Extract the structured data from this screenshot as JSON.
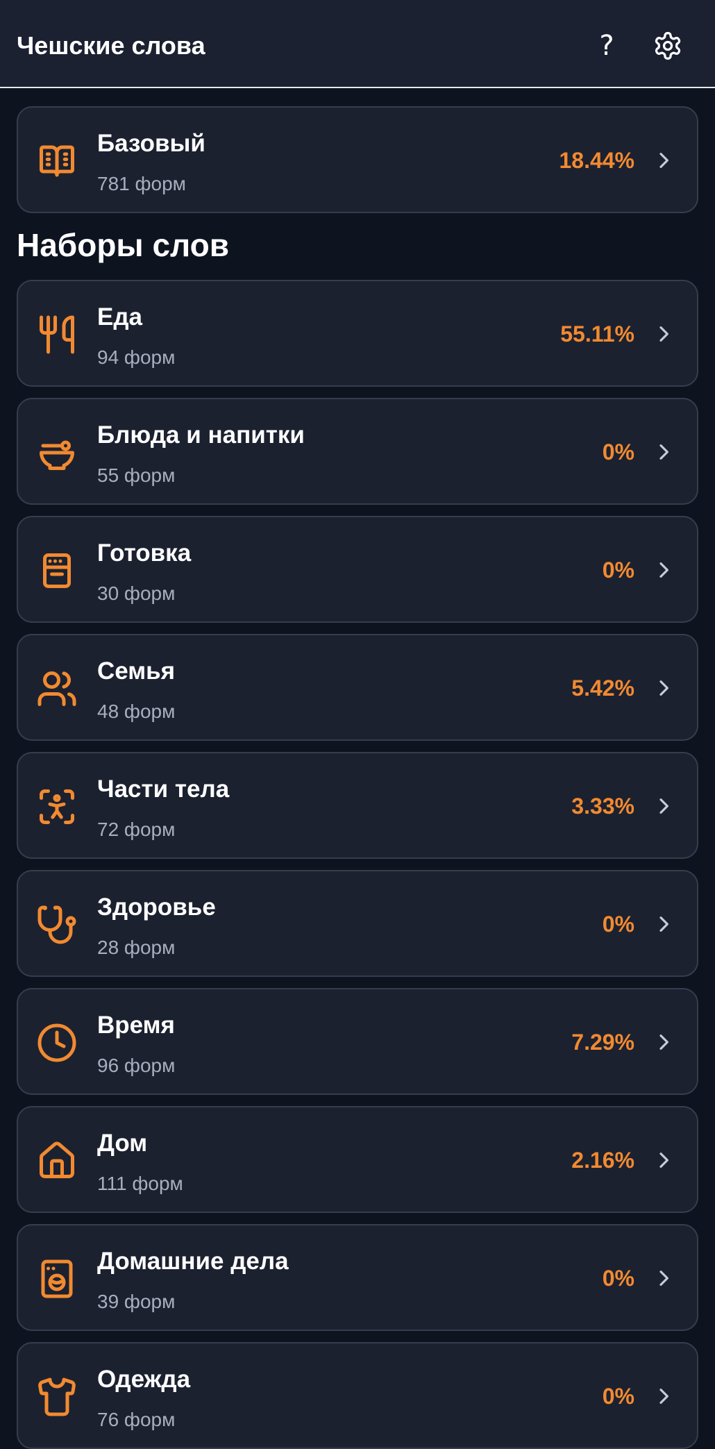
{
  "header": {
    "title": "Чешские слова",
    "help_icon": "question-icon",
    "settings_icon": "gear-icon"
  },
  "base_set": {
    "name": "Базовый",
    "forms": "781 форм",
    "progress": "18.44%",
    "icon": "book-icon"
  },
  "section_title": "Наборы слов",
  "sets": [
    {
      "name": "Еда",
      "forms": "94 форм",
      "progress": "55.11%",
      "icon": "utensils-icon"
    },
    {
      "name": "Блюда и напитки",
      "forms": "55 форм",
      "progress": "0%",
      "icon": "bowl-icon"
    },
    {
      "name": "Готовка",
      "forms": "30 форм",
      "progress": "0%",
      "icon": "stove-icon"
    },
    {
      "name": "Семья",
      "forms": "48 форм",
      "progress": "5.42%",
      "icon": "users-icon"
    },
    {
      "name": "Части тела",
      "forms": "72 форм",
      "progress": "3.33%",
      "icon": "body-scan-icon"
    },
    {
      "name": "Здоровье",
      "forms": "28 форм",
      "progress": "0%",
      "icon": "stethoscope-icon"
    },
    {
      "name": "Время",
      "forms": "96 форм",
      "progress": "7.29%",
      "icon": "clock-icon"
    },
    {
      "name": "Дом",
      "forms": "111 форм",
      "progress": "2.16%",
      "icon": "house-icon"
    },
    {
      "name": "Домашние дела",
      "forms": "39 форм",
      "progress": "0%",
      "icon": "washing-machine-icon"
    },
    {
      "name": "Одежда",
      "forms": "76 форм",
      "progress": "0%",
      "icon": "shirt-icon"
    }
  ],
  "colors": {
    "accent": "#f28a30",
    "background": "#0e1320",
    "card": "#1c2130",
    "header": "#1b2131"
  }
}
